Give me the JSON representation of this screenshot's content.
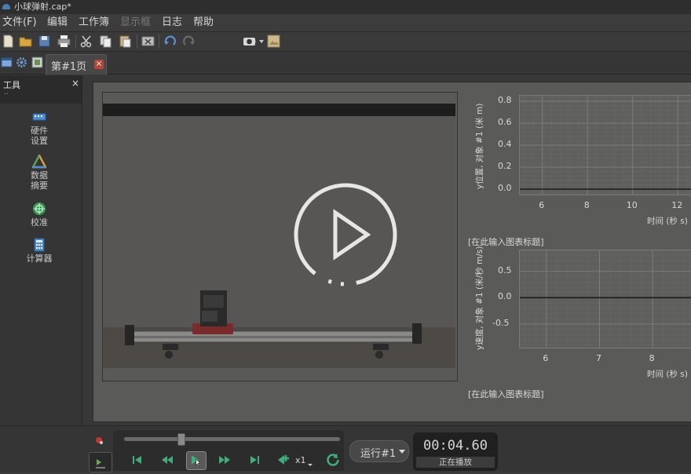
{
  "window": {
    "title": "小球弹射.cap*"
  },
  "menu": {
    "items": [
      "文件(F)",
      "编辑",
      "工作簿",
      "显示框",
      "日志",
      "帮助"
    ]
  },
  "toolbar": {
    "icons": [
      "new-file-icon",
      "open-folder-icon",
      "save-icon",
      "print-icon",
      "cut-icon",
      "copy-icon",
      "paste-icon",
      "delete-icon",
      "undo-icon",
      "redo-icon",
      "camera-icon",
      "image-icon"
    ]
  },
  "tabs": {
    "page_tab_label": "第#1页",
    "close_glyph": "×"
  },
  "tools": {
    "title": "工具",
    "close": "×",
    "handle": "..",
    "items": [
      {
        "label_line1": "硬件",
        "label_line2": "设置",
        "icon": "hardware-icon"
      },
      {
        "label_line1": "数据",
        "label_line2": "摘要",
        "icon": "data-summary-icon"
      },
      {
        "label_line1": "校准",
        "label_line2": "",
        "icon": "calibrate-icon"
      },
      {
        "label_line1": "计算器",
        "label_line2": "",
        "icon": "calculator-icon"
      }
    ]
  },
  "video": {
    "play_overlay_icon": "play-circle-icon"
  },
  "charts": {
    "chart1": {
      "title": "",
      "ylabel": "y位置, 对象 #1 (米 m)",
      "xlabel": "时间 (秒 s)"
    },
    "chart2": {
      "title": "[在此输入图表标题]",
      "ylabel": "y速度, 对象 #1 (米/秒 m/s)",
      "xlabel": "时间 (秒 s)"
    },
    "chart3": {
      "title": "[在此输入图表标题]"
    }
  },
  "chart_data": [
    {
      "type": "line",
      "title": "",
      "xlabel": "时间 (秒 s)",
      "ylabel": "y位置, 对象 #1 (米 m)",
      "xticks": [
        "6",
        "8",
        "10",
        "12"
      ],
      "yticks": [
        "0.8",
        "0.6",
        "0.4",
        "0.2",
        "0.0"
      ],
      "xlim": [
        5,
        13
      ],
      "ylim": [
        -0.05,
        0.85
      ],
      "grid": true,
      "series": [
        {
          "x": [
            5,
            13
          ],
          "y": [
            0.0,
            0.0
          ]
        }
      ]
    },
    {
      "type": "line",
      "title": "[在此输入图表标题]",
      "xlabel": "时间 (秒 s)",
      "ylabel": "y速度, 对象 #1 (米/秒 m/s)",
      "xticks": [
        "6",
        "7",
        "8"
      ],
      "yticks": [
        "0.5",
        "0.0",
        "-0.5"
      ],
      "xlim": [
        5.5,
        8.9
      ],
      "ylim": [
        -0.95,
        0.9
      ],
      "grid": true,
      "series": [
        {
          "x": [
            5.5,
            8.9
          ],
          "y": [
            0.0,
            0.0
          ]
        }
      ]
    }
  ],
  "playback": {
    "slider_position": 0.26,
    "speed_label": "x1",
    "run_label": "运行#1",
    "time": "00:04.60",
    "status": "正在播放"
  }
}
